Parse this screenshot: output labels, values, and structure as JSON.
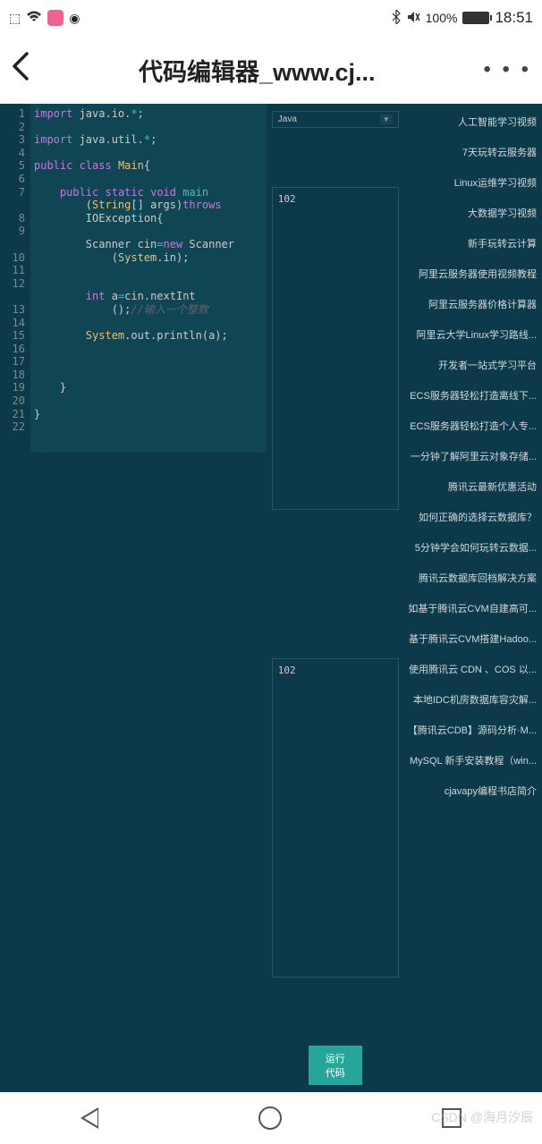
{
  "status": {
    "battery_pct": "100%",
    "time": "18:51"
  },
  "header": {
    "title": "代码编辑器_www.cj..."
  },
  "editor": {
    "line_count": 22,
    "code_tokens": [
      [
        {
          "t": "kw",
          "v": "import"
        },
        {
          "t": "",
          "v": " java.io."
        },
        {
          "t": "op",
          "v": "*"
        },
        {
          "t": "",
          "v": ";"
        }
      ],
      [],
      [
        {
          "t": "kw",
          "v": "import"
        },
        {
          "t": "",
          "v": " java.util."
        },
        {
          "t": "op",
          "v": "*"
        },
        {
          "t": "",
          "v": ";"
        }
      ],
      [],
      [
        {
          "t": "kw",
          "v": "public"
        },
        {
          "t": "",
          "v": " "
        },
        {
          "t": "kw",
          "v": "class"
        },
        {
          "t": "",
          "v": " "
        },
        {
          "t": "cls",
          "v": "Main"
        },
        {
          "t": "",
          "v": "{"
        }
      ],
      [],
      [
        {
          "t": "",
          "v": "    "
        },
        {
          "t": "kw",
          "v": "public"
        },
        {
          "t": "",
          "v": " "
        },
        {
          "t": "kw",
          "v": "static"
        },
        {
          "t": "",
          "v": " "
        },
        {
          "t": "kw",
          "v": "void"
        },
        {
          "t": "",
          "v": " "
        },
        {
          "t": "fn",
          "v": "main"
        }
      ],
      [
        {
          "t": "",
          "v": "        ("
        },
        {
          "t": "cls",
          "v": "String"
        },
        {
          "t": "",
          "v": "[] args)"
        },
        {
          "t": "kw",
          "v": "throws"
        }
      ],
      [
        {
          "t": "",
          "v": "        IOException{"
        }
      ],
      [],
      [
        {
          "t": "",
          "v": "        Scanner cin"
        },
        {
          "t": "op",
          "v": "="
        },
        {
          "t": "kw",
          "v": "new"
        },
        {
          "t": "",
          "v": " Scanner"
        }
      ],
      [
        {
          "t": "",
          "v": "            ("
        },
        {
          "t": "cls",
          "v": "System"
        },
        {
          "t": "",
          "v": ".in);"
        }
      ],
      [],
      [],
      [
        {
          "t": "",
          "v": "        "
        },
        {
          "t": "kw",
          "v": "int"
        },
        {
          "t": "",
          "v": " a"
        },
        {
          "t": "op",
          "v": "="
        },
        {
          "t": "",
          "v": "cin.nextInt"
        }
      ],
      [
        {
          "t": "",
          "v": "            ();"
        },
        {
          "t": "cmt",
          "v": "//输入一个整数"
        }
      ],
      [],
      [
        {
          "t": "",
          "v": "        "
        },
        {
          "t": "cls",
          "v": "System"
        },
        {
          "t": "",
          "v": ".out.println(a);"
        }
      ],
      [],
      [],
      [],
      [
        {
          "t": "",
          "v": "    }"
        }
      ],
      [],
      [
        {
          "t": "",
          "v": "}"
        }
      ]
    ],
    "visible_lines": [
      "1",
      "2",
      "3",
      "4",
      "5",
      "6",
      "7",
      "",
      "8",
      "9",
      "",
      "10",
      "11",
      "12",
      "",
      "13",
      "14",
      "15",
      "16",
      "17",
      "18",
      "19",
      "20",
      "21",
      "22"
    ]
  },
  "lang_select": {
    "value": "Java"
  },
  "io": {
    "box1": "102",
    "box2": "102"
  },
  "run_button": "运行代码",
  "links": [
    "人工智能学习视频",
    "7天玩转云服务器",
    "Linux运维学习视频",
    "大数据学习视频",
    "新手玩转云计算",
    "阿里云服务器使用视频教程",
    "阿里云服务器价格计算器",
    "阿里云大学Linux学习路线...",
    "开发者一站式学习平台",
    "ECS服务器轻松打造离线下...",
    "ECS服务器轻松打造个人专...",
    "一分钟了解阿里云对象存储...",
    "腾讯云最新优惠活动",
    "如何正确的选择云数据库？",
    "5分钟学会如何玩转云数据...",
    "腾讯云数据库回档解决方案",
    "如基于腾讯云CVM自建高可...",
    "基于腾讯云CVM搭建Hadoo...",
    "使用腾讯云 CDN 、COS 以...",
    "本地IDC机房数据库容灾解...",
    "【腾讯云CDB】源码分析·M...",
    "MySQL 新手安装教程（win...",
    "cjavapy编程书店简介"
  ],
  "watermark": "CSDN @海月汐辰"
}
